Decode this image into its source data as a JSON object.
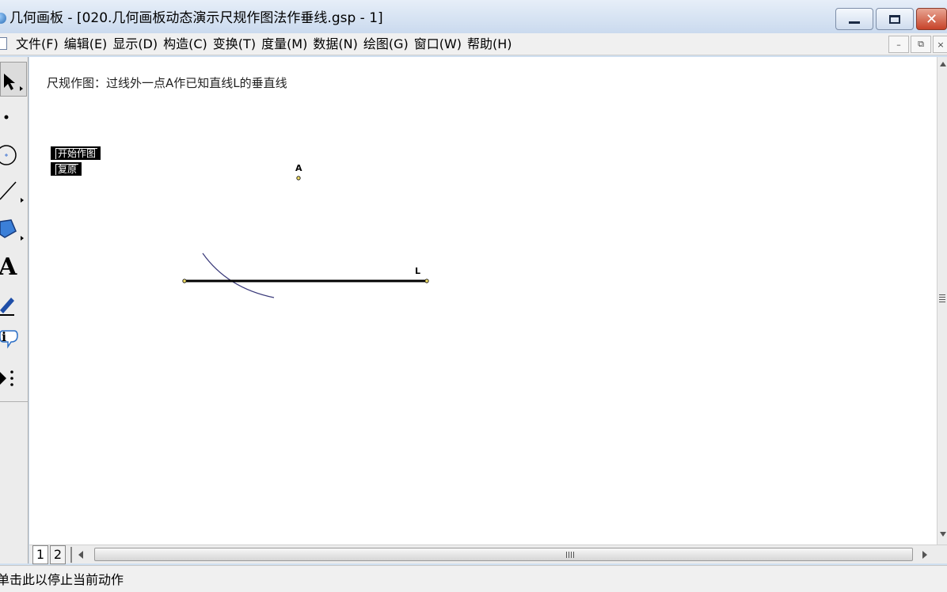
{
  "window": {
    "title": "几何画板 - [020.几何画板动态演示尺规作图法作垂线.gsp - 1]",
    "close_glyph": "✕"
  },
  "menu": {
    "items": [
      "文件(F)",
      "编辑(E)",
      "显示(D)",
      "构造(C)",
      "变换(T)",
      "度量(M)",
      "数据(N)",
      "绘图(G)",
      "窗口(W)",
      "帮助(H)"
    ],
    "mdi_min": "–",
    "mdi_restore": "⧉",
    "mdi_close": "×"
  },
  "toolbox": {
    "tools": [
      "arrow-select-tool",
      "point-tool",
      "compass-tool",
      "straightedge-tool",
      "polygon-tool",
      "text-tool",
      "marker-tool",
      "information-tool",
      "custom-tool"
    ],
    "text_tool_glyph": "A"
  },
  "canvas": {
    "caption": "尺规作图：过线外一点A作已知直线L的垂直线",
    "buttons": {
      "start": "开始作图",
      "reset": "复原"
    },
    "point_label": "A",
    "line_label": "L",
    "colors": {
      "arc": "#3a3a7a",
      "line": "#000000",
      "point_fill": "#f5e36a"
    }
  },
  "pages": {
    "tabs": [
      "1",
      "2"
    ]
  },
  "status": {
    "text": "单击此以停止当前动作"
  }
}
